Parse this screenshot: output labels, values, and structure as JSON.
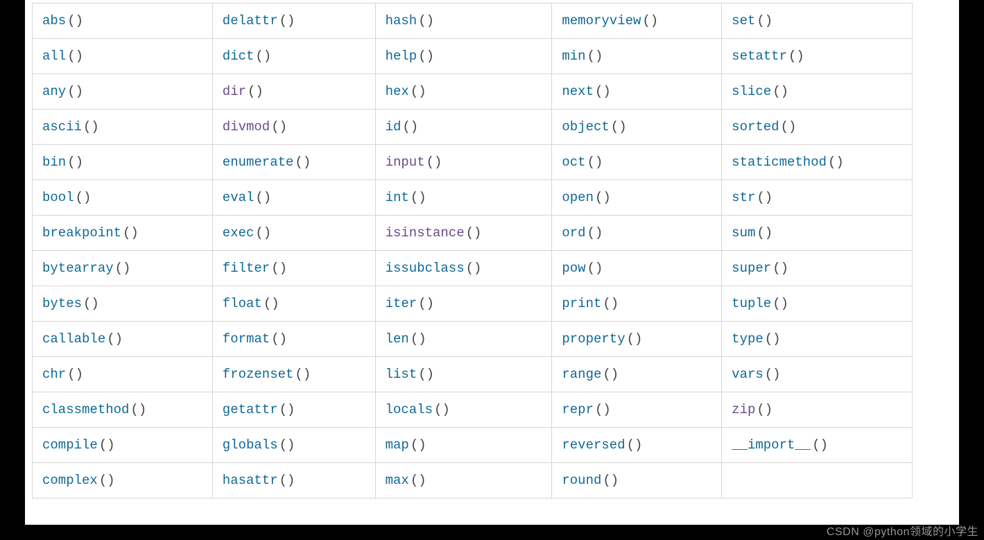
{
  "table": {
    "rows": [
      [
        {
          "name": "abs",
          "color": "teal"
        },
        {
          "name": "delattr",
          "color": "teal"
        },
        {
          "name": "hash",
          "color": "teal"
        },
        {
          "name": "memoryview",
          "color": "teal"
        },
        {
          "name": "set",
          "color": "teal"
        }
      ],
      [
        {
          "name": "all",
          "color": "teal"
        },
        {
          "name": "dict",
          "color": "teal"
        },
        {
          "name": "help",
          "color": "teal"
        },
        {
          "name": "min",
          "color": "teal"
        },
        {
          "name": "setattr",
          "color": "teal"
        }
      ],
      [
        {
          "name": "any",
          "color": "teal"
        },
        {
          "name": "dir",
          "color": "visited"
        },
        {
          "name": "hex",
          "color": "teal"
        },
        {
          "name": "next",
          "color": "teal"
        },
        {
          "name": "slice",
          "color": "teal"
        }
      ],
      [
        {
          "name": "ascii",
          "color": "teal"
        },
        {
          "name": "divmod",
          "color": "visited"
        },
        {
          "name": "id",
          "color": "teal"
        },
        {
          "name": "object",
          "color": "teal"
        },
        {
          "name": "sorted",
          "color": "teal"
        }
      ],
      [
        {
          "name": "bin",
          "color": "teal"
        },
        {
          "name": "enumerate",
          "color": "teal"
        },
        {
          "name": "input",
          "color": "visited"
        },
        {
          "name": "oct",
          "color": "teal"
        },
        {
          "name": "staticmethod",
          "color": "teal"
        }
      ],
      [
        {
          "name": "bool",
          "color": "teal"
        },
        {
          "name": "eval",
          "color": "teal"
        },
        {
          "name": "int",
          "color": "teal"
        },
        {
          "name": "open",
          "color": "teal"
        },
        {
          "name": "str",
          "color": "teal"
        }
      ],
      [
        {
          "name": "breakpoint",
          "color": "teal"
        },
        {
          "name": "exec",
          "color": "teal"
        },
        {
          "name": "isinstance",
          "color": "visited"
        },
        {
          "name": "ord",
          "color": "teal"
        },
        {
          "name": "sum",
          "color": "teal"
        }
      ],
      [
        {
          "name": "bytearray",
          "color": "teal"
        },
        {
          "name": "filter",
          "color": "teal"
        },
        {
          "name": "issubclass",
          "color": "teal"
        },
        {
          "name": "pow",
          "color": "teal"
        },
        {
          "name": "super",
          "color": "teal"
        }
      ],
      [
        {
          "name": "bytes",
          "color": "teal"
        },
        {
          "name": "float",
          "color": "teal"
        },
        {
          "name": "iter",
          "color": "teal"
        },
        {
          "name": "print",
          "color": "teal"
        },
        {
          "name": "tuple",
          "color": "teal"
        }
      ],
      [
        {
          "name": "callable",
          "color": "teal"
        },
        {
          "name": "format",
          "color": "teal"
        },
        {
          "name": "len",
          "color": "teal"
        },
        {
          "name": "property",
          "color": "teal"
        },
        {
          "name": "type",
          "color": "teal"
        }
      ],
      [
        {
          "name": "chr",
          "color": "teal"
        },
        {
          "name": "frozenset",
          "color": "teal"
        },
        {
          "name": "list",
          "color": "teal"
        },
        {
          "name": "range",
          "color": "teal"
        },
        {
          "name": "vars",
          "color": "teal"
        }
      ],
      [
        {
          "name": "classmethod",
          "color": "teal"
        },
        {
          "name": "getattr",
          "color": "teal"
        },
        {
          "name": "locals",
          "color": "teal"
        },
        {
          "name": "repr",
          "color": "teal"
        },
        {
          "name": "zip",
          "color": "visited"
        }
      ],
      [
        {
          "name": "compile",
          "color": "teal"
        },
        {
          "name": "globals",
          "color": "teal"
        },
        {
          "name": "map",
          "color": "teal"
        },
        {
          "name": "reversed",
          "color": "teal"
        },
        {
          "name": "__import__",
          "color": "teal"
        }
      ],
      [
        {
          "name": "complex",
          "color": "teal"
        },
        {
          "name": "hasattr",
          "color": "teal"
        },
        {
          "name": "max",
          "color": "teal"
        },
        {
          "name": "round",
          "color": "teal"
        },
        {
          "name": "",
          "color": "teal"
        }
      ]
    ]
  },
  "paren": "()",
  "watermark": "CSDN @python领域的小学生",
  "col_widths": [
    "260px",
    "235px",
    "255px",
    "245px",
    "275px"
  ]
}
